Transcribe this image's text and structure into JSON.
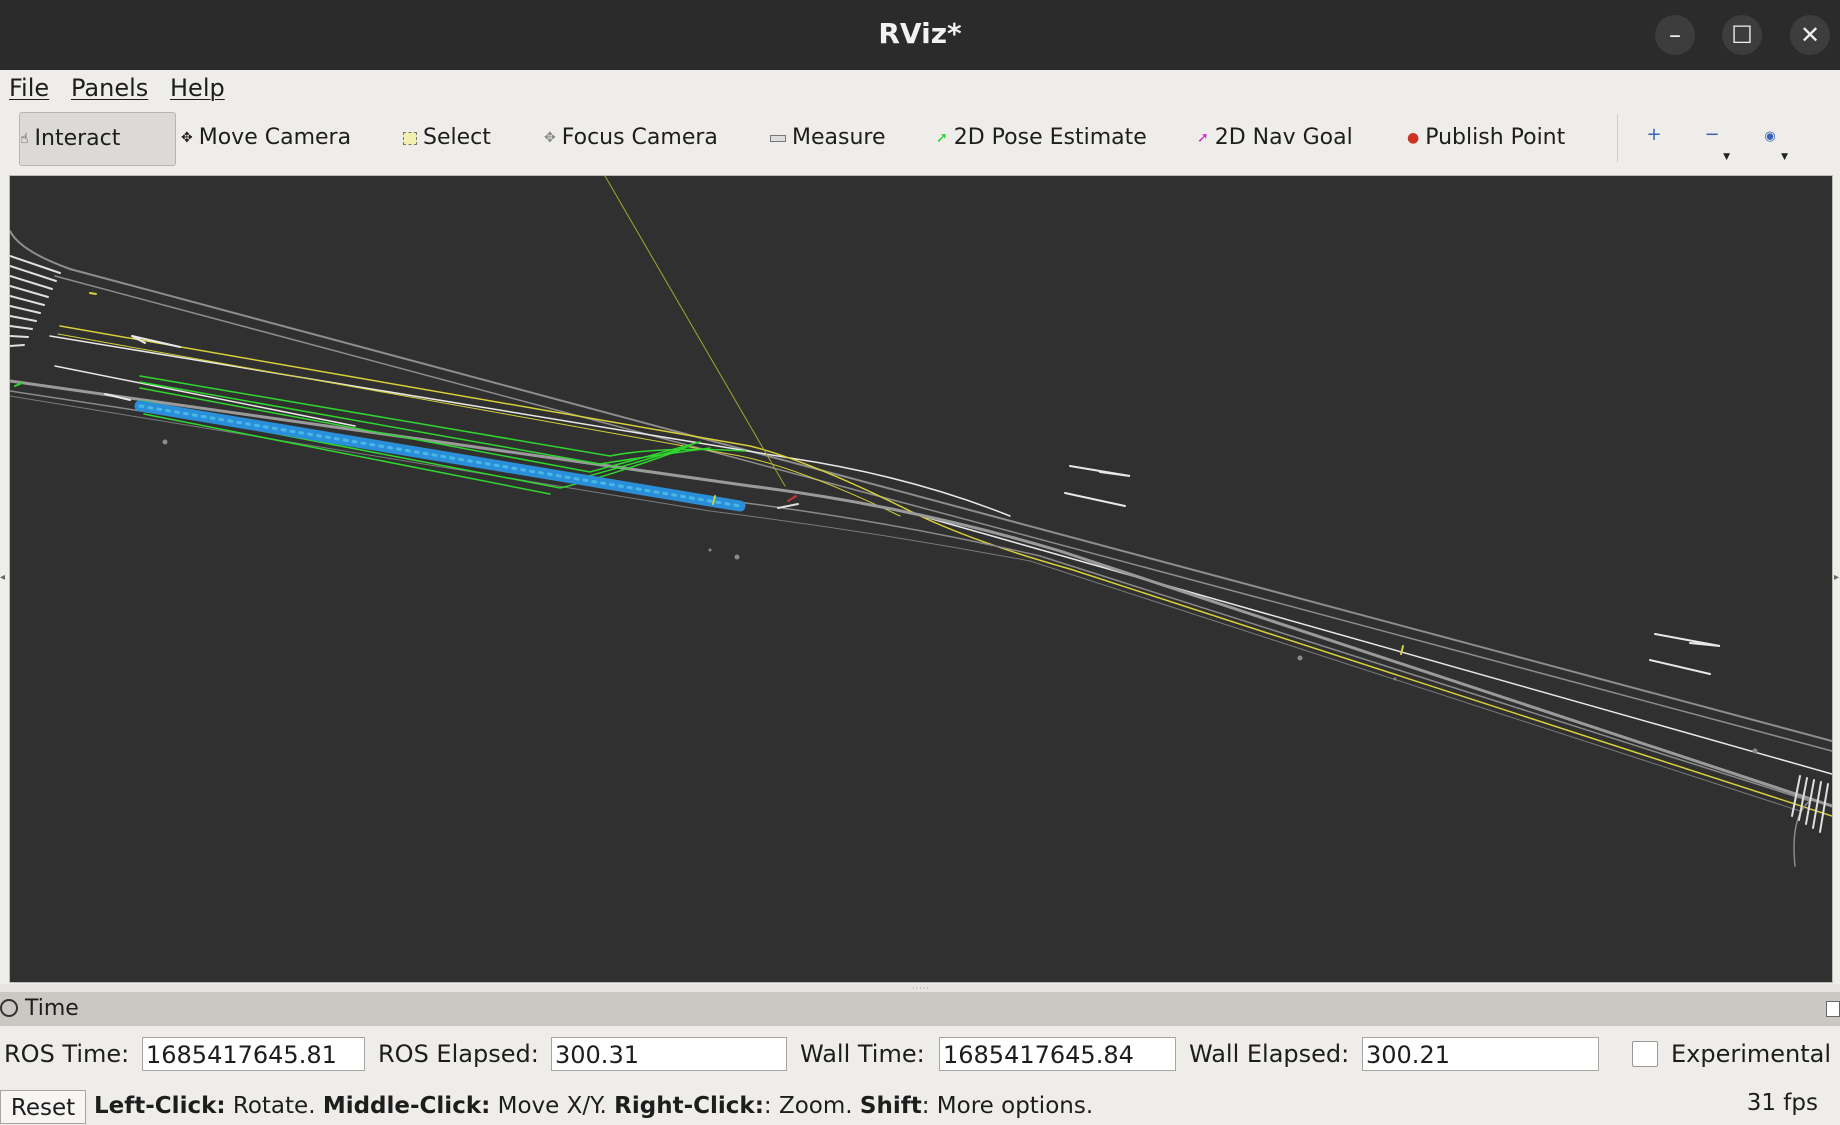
{
  "window": {
    "title": "RViz*",
    "minimize": "–",
    "maximize": "☐",
    "close": "✕"
  },
  "menu": {
    "file": "File",
    "panels": "Panels",
    "help": "Help"
  },
  "toolbar": {
    "interact": "Interact",
    "move_camera": "Move Camera",
    "select": "Select",
    "focus_camera": "Focus Camera",
    "measure": "Measure",
    "pose_estimate": "2D Pose Estimate",
    "nav_goal": "2D Nav Goal",
    "publish_point": "Publish Point",
    "zoom_in": "+",
    "zoom_out": "−",
    "view": "◉"
  },
  "tool_colors": {
    "pose_estimate": "#22cc22",
    "nav_goal": "#cc22cc",
    "publish_point": "#cc3322"
  },
  "time_panel": {
    "title": "Time",
    "ros_time_label": "ROS Time:",
    "ros_time": "1685417645.81",
    "ros_elapsed_label": "ROS Elapsed:",
    "ros_elapsed": "300.31",
    "wall_time_label": "Wall Time:",
    "wall_time": "1685417645.84",
    "wall_elapsed_label": "Wall Elapsed:",
    "wall_elapsed": "300.21",
    "experimental_label": "Experimental",
    "experimental_checked": false
  },
  "status": {
    "reset": "Reset",
    "left_click": "Left-Click:",
    "rotate": " Rotate. ",
    "middle_click": "Middle-Click:",
    "move": " Move X/Y. ",
    "right_click": "Right-Click:",
    "zoom": ": Zoom. ",
    "shift": "Shift",
    "more": ": More options.",
    "fps": "31 fps"
  }
}
